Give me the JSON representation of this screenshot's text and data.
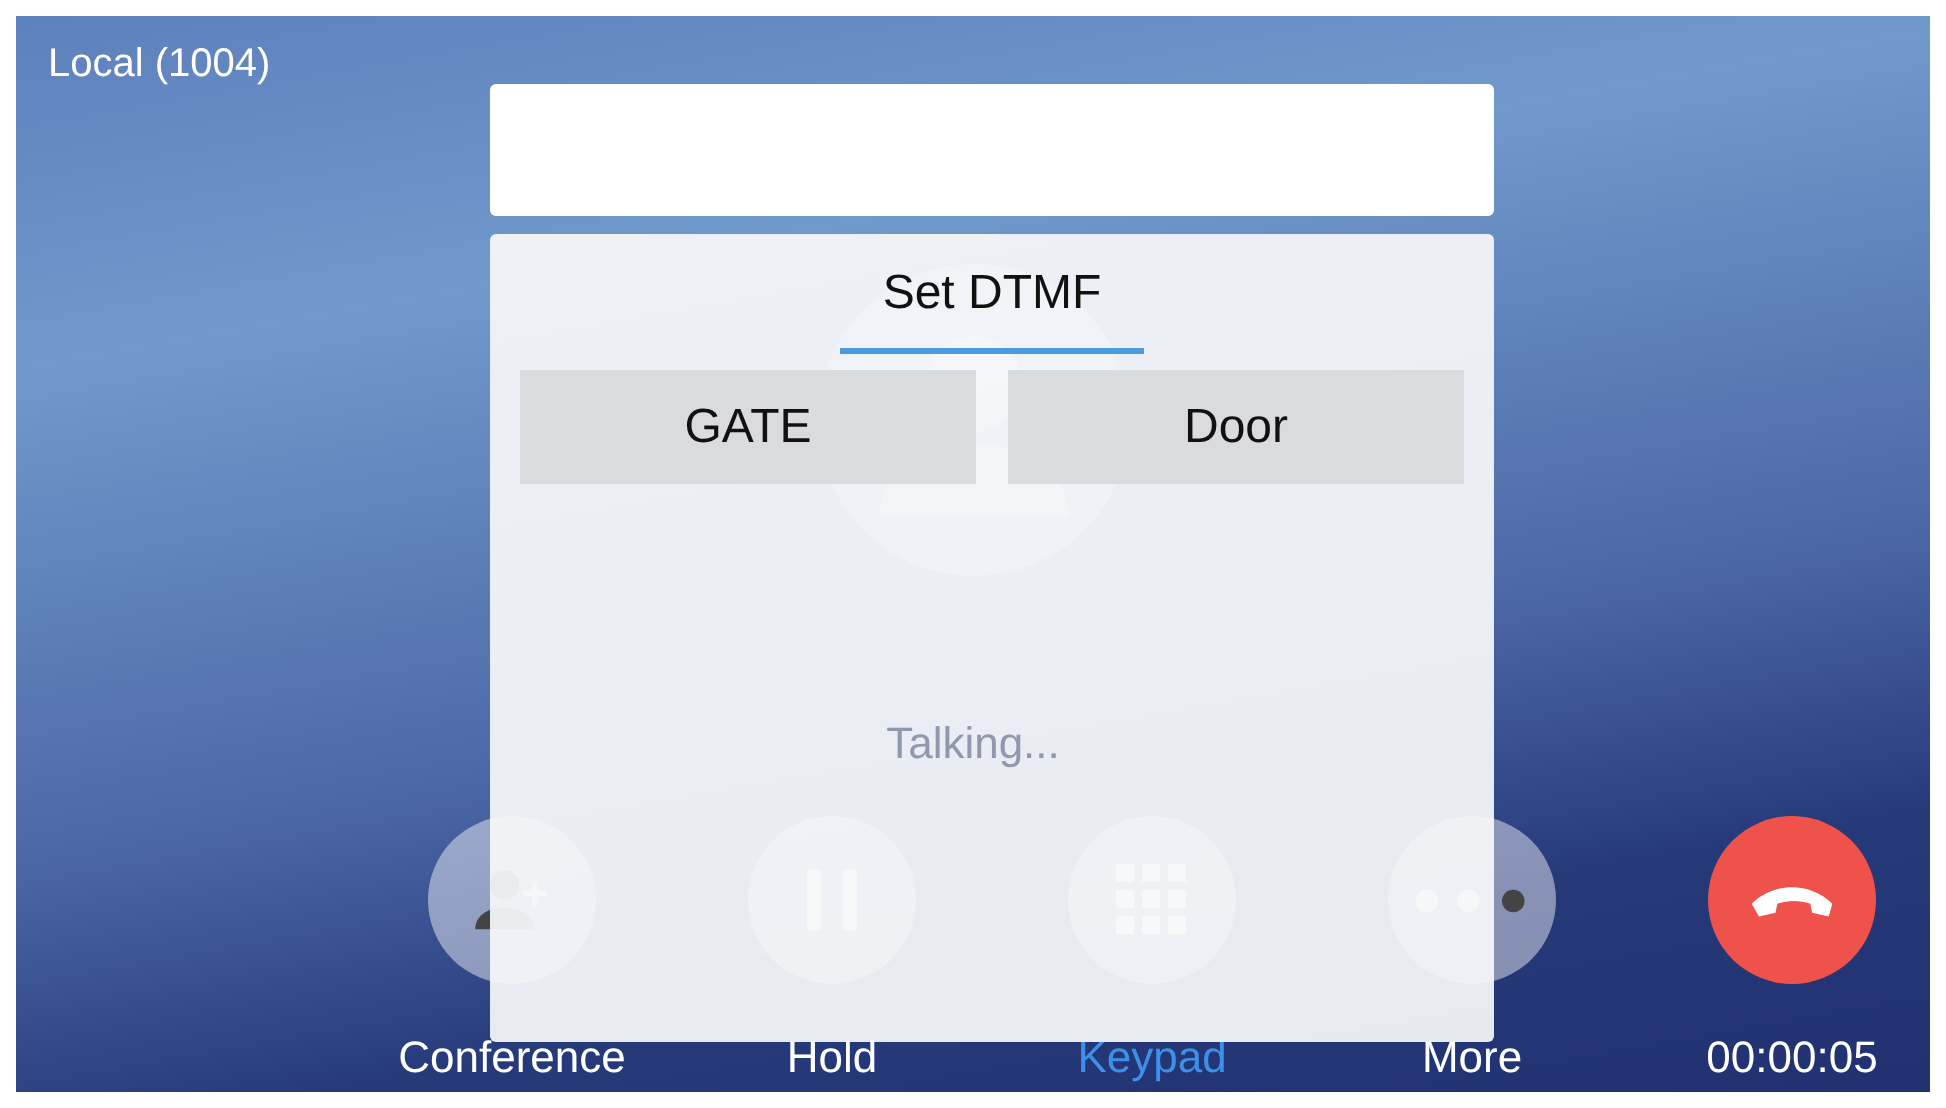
{
  "local_line": "Local (1004)",
  "call": {
    "status": "Talking...",
    "duration": "00:00:05"
  },
  "dtmf_dialog": {
    "title": "Set DTMF",
    "options": [
      {
        "label": "GATE"
      },
      {
        "label": "Door"
      }
    ]
  },
  "actions": [
    {
      "kind": "conference",
      "label": "Conference",
      "selected": false
    },
    {
      "kind": "hold",
      "label": "Hold",
      "selected": false
    },
    {
      "kind": "keypad",
      "label": "Keypad",
      "selected": true
    },
    {
      "kind": "more",
      "label": "More",
      "selected": false
    },
    {
      "kind": "hangup"
    }
  ]
}
